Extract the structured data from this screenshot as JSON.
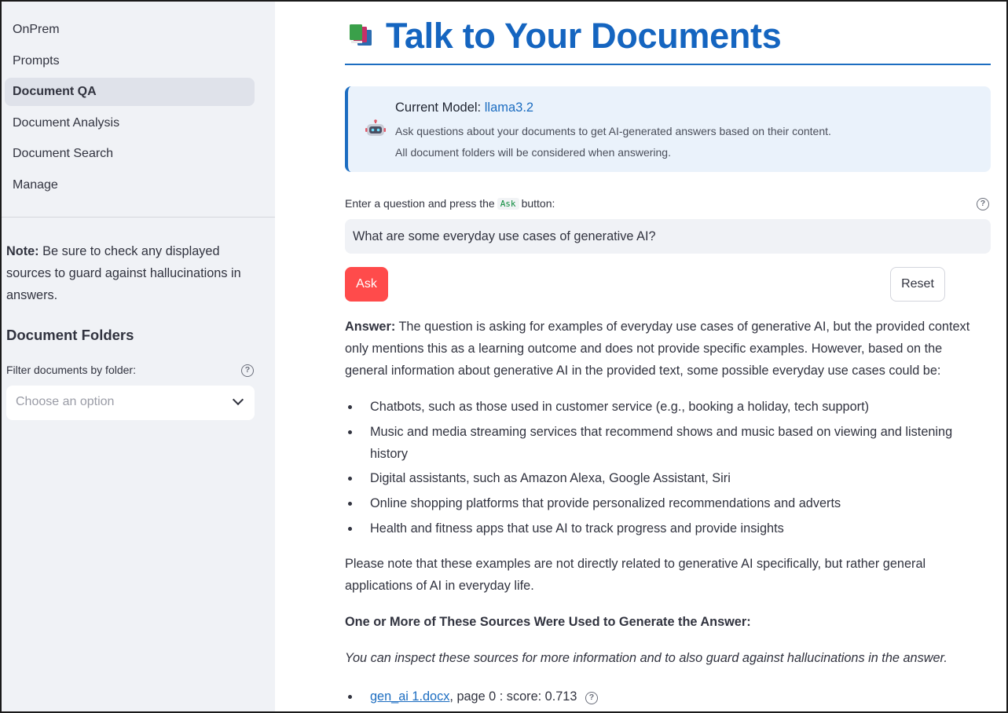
{
  "sidebar": {
    "nav": [
      {
        "label": "OnPrem",
        "active": false
      },
      {
        "label": "Prompts",
        "active": false
      },
      {
        "label": "Document QA",
        "active": true
      },
      {
        "label": "Document Analysis",
        "active": false
      },
      {
        "label": "Document Search",
        "active": false
      },
      {
        "label": "Manage",
        "active": false
      }
    ],
    "note_label": "Note:",
    "note_text": "Be sure to check any displayed sources to guard against hallucinations in answers.",
    "folders_title": "Document Folders",
    "filter_label": "Filter documents by folder:",
    "filter_placeholder": "Choose an option"
  },
  "main": {
    "title_icon": "books-icon",
    "title": "Talk to Your Documents",
    "info": {
      "icon": "robot-icon",
      "model_label": "Current Model:",
      "model_name": "llama3.2",
      "line1": "Ask questions about your documents to get AI-generated answers based on their content.",
      "line2": "All document folders will be considered when answering."
    },
    "question_label_before": "Enter a question and press the",
    "question_label_code": "Ask",
    "question_label_after": "button:",
    "question_value": "What are some everyday use cases of generative AI?",
    "ask_button": "Ask",
    "reset_button": "Reset",
    "answer_label": "Answer:",
    "answer_text": "The question is asking for examples of everyday use cases of generative AI, but the provided context only mentions this as a learning outcome and does not provide specific examples. However, based on the general information about generative AI in the provided text, some possible everyday use cases could be:",
    "bullets": [
      "Chatbots, such as those used in customer service (e.g., booking a holiday, tech support)",
      "Music and media streaming services that recommend shows and music based on viewing and listening history",
      "Digital assistants, such as Amazon Alexa, Google Assistant, Siri",
      "Online shopping platforms that provide personalized recommendations and adverts",
      "Health and fitness apps that use AI to track progress and provide insights"
    ],
    "closing": "Please note that these examples are not directly related to generative AI specifically, but rather general applications of AI in everyday life.",
    "sources_heading": "One or More of These Sources Were Used to Generate the Answer:",
    "sources_note": "You can inspect these sources for more information and to also guard against hallucinations in the answer.",
    "sources": [
      {
        "file": "gen_ai 1.docx",
        "detail": ", page 0 : score: 0.713"
      }
    ]
  },
  "colors": {
    "accent": "#1565c0",
    "ask_button": "#ff4b4b",
    "sidebar_bg": "#f0f2f6",
    "info_bg": "#eaf2fb"
  }
}
